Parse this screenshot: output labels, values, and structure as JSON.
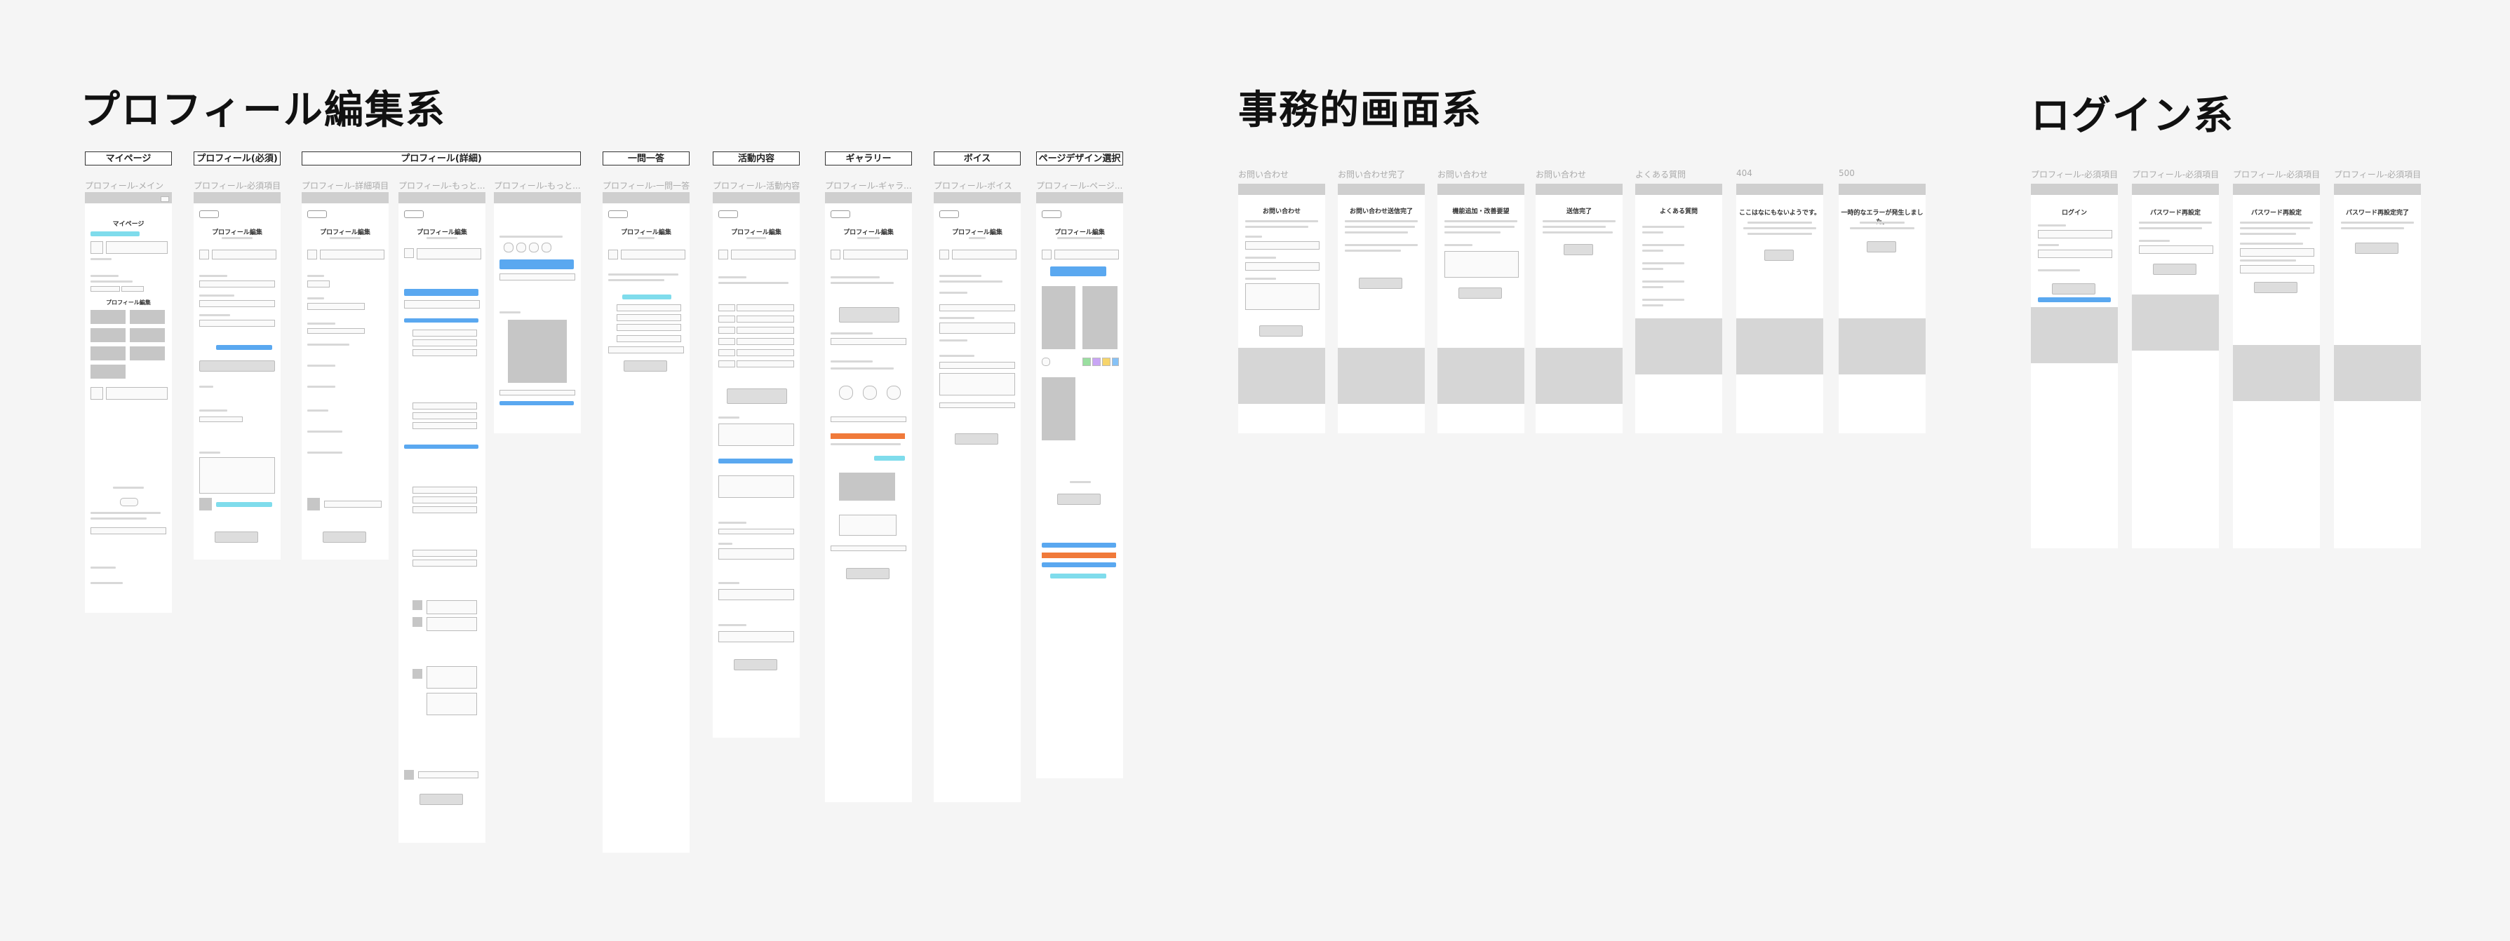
{
  "sections": [
    {
      "title": "プロフィール編集系"
    },
    {
      "title": "事務的画面系"
    },
    {
      "title": "ログイン系"
    }
  ],
  "profile_headers": [
    "マイページ",
    "プロフィール(必須)",
    "プロフィール(詳細)",
    "一問一答",
    "活動内容",
    "ギャラリー",
    "ボイス",
    "ページデザイン選択"
  ],
  "profile_frames": [
    {
      "label": "プロフィール-メイン",
      "title": "マイページ"
    },
    {
      "label": "プロフィール-必須項目",
      "title": "プロフィール編集"
    },
    {
      "label": "プロフィール-詳細項目",
      "title": "プロフィール編集"
    },
    {
      "label": "プロフィール-もっと...",
      "title": "プロフィール編集"
    },
    {
      "label": "プロフィール-もっと...",
      "title": ""
    },
    {
      "label": "プロフィール-一問一答",
      "title": "プロフィール編集"
    },
    {
      "label": "プロフィール-活動内容",
      "title": "プロフィール編集"
    },
    {
      "label": "プロフィール-ギャラ...",
      "title": "プロフィール編集"
    },
    {
      "label": "プロフィール-ボイス",
      "title": "プロフィール編集"
    },
    {
      "label": "プロフィール-ページ...",
      "title": "プロフィール編集"
    }
  ],
  "office_frames": [
    {
      "label": "お問い合わせ",
      "title": "お問い合わせ"
    },
    {
      "label": "お問い合わせ完了",
      "title": "お問い合わせ送信完了"
    },
    {
      "label": "お問い合わせ",
      "title": "機能追加・改善要望"
    },
    {
      "label": "お問い合わせ",
      "title": "送信完了"
    },
    {
      "label": "よくある質問",
      "title": "よくある質問"
    },
    {
      "label": "404",
      "title": "ここはなにもないようです。"
    },
    {
      "label": "500",
      "title": "一時的なエラーが発生しました。"
    }
  ],
  "login_frames": [
    {
      "label": "プロフィール-必須項目",
      "title": "ログイン"
    },
    {
      "label": "プロフィール-必須項目",
      "title": "パスワード再設定"
    },
    {
      "label": "プロフィール-必須項目",
      "title": "パスワード再設定"
    },
    {
      "label": "プロフィール-必須項目",
      "title": "パスワード再設定完了"
    }
  ]
}
